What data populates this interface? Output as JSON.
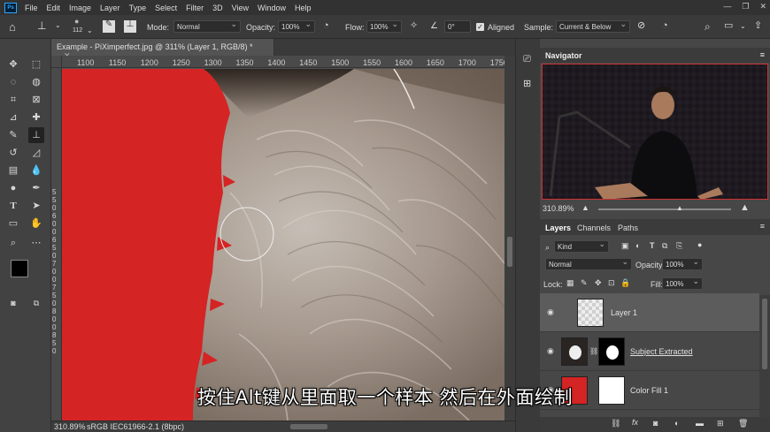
{
  "menu": [
    "File",
    "Edit",
    "Image",
    "Layer",
    "Type",
    "Select",
    "Filter",
    "3D",
    "View",
    "Window",
    "Help"
  ],
  "app_logo": "Ps",
  "options": {
    "brush_size": "112",
    "mode_label": "Mode:",
    "mode_value": "Normal",
    "opacity_label": "Opacity:",
    "opacity_value": "100%",
    "flow_label": "Flow:",
    "flow_value": "100%",
    "angle_value": "0°",
    "aligned_label": "Aligned",
    "sample_label": "Sample:",
    "sample_value": "Current & Below"
  },
  "document_tab": "Example - PiXimperfect.jpg @ 311% (Layer 1, RGB/8) *",
  "ruler_h": [
    "1100",
    "1150",
    "1200",
    "1250",
    "1300",
    "1350",
    "1400",
    "1450",
    "1500",
    "1550",
    "1600",
    "1650",
    "1700",
    "1750"
  ],
  "ruler_v": [
    "5",
    "5",
    "0",
    "6",
    "0",
    "0",
    "6",
    "5",
    "0",
    "7",
    "0",
    "0",
    "7",
    "5",
    "0",
    "8",
    "0",
    "0",
    "8",
    "5",
    "0"
  ],
  "status": {
    "zoom": "310.89%",
    "profile": "sRGB IEC61966-2.1 (8bpc)"
  },
  "navigator": {
    "title": "Navigator",
    "zoom": "310.89%"
  },
  "layers_panel": {
    "tabs": [
      "Layers",
      "Channels",
      "Paths"
    ],
    "kind_label": "Kind",
    "blend_mode": "Normal",
    "opacity_label": "Opacity:",
    "opacity_value": "100%",
    "lock_label": "Lock:",
    "fill_label": "Fill:",
    "fill_value": "100%",
    "layers": [
      {
        "name": "Layer 1"
      },
      {
        "name": "Subject Extracted"
      },
      {
        "name": "Color Fill 1"
      }
    ]
  },
  "subtitle": "按住Alt键从里面取一个样本 然后在外面绘制",
  "colors": {
    "fill_red": "#d42424",
    "accent": "#31a8ff"
  }
}
